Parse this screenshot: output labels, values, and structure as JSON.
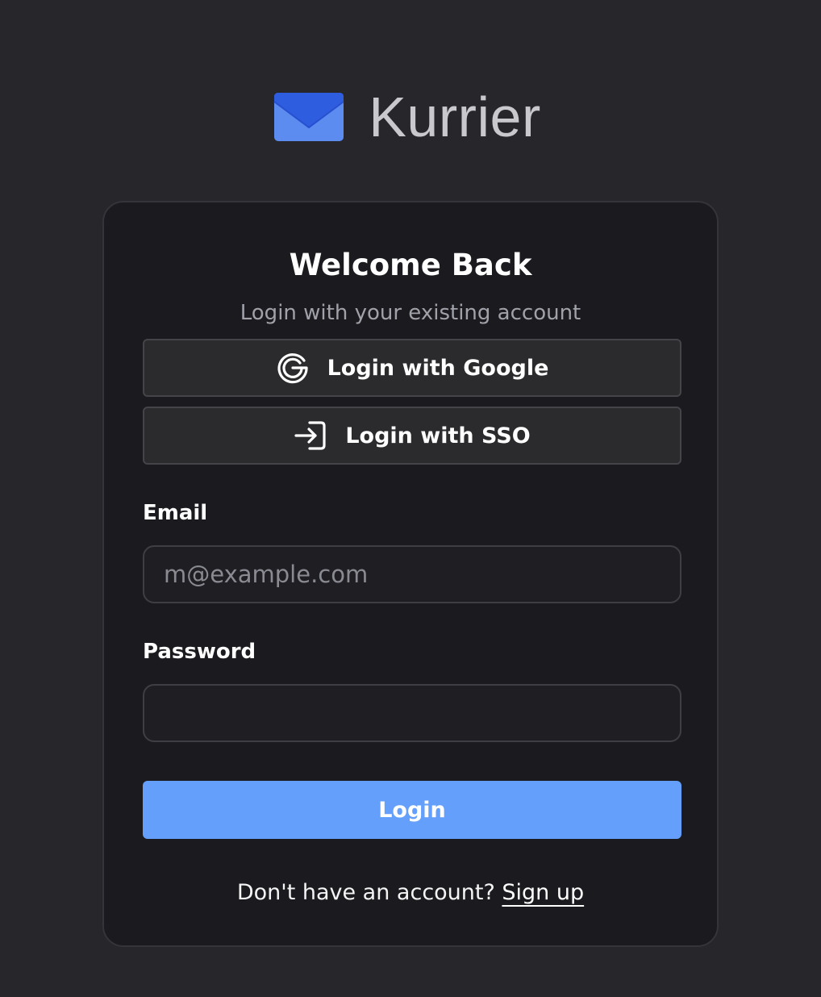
{
  "brand": {
    "name": "Kurrier",
    "icon": "envelope-icon",
    "color": "#3b67e8"
  },
  "card": {
    "title": "Welcome Back",
    "subtitle": "Login with your existing account"
  },
  "oauth": {
    "google": {
      "label": "Login with Google",
      "icon": "google-icon"
    },
    "sso": {
      "label": "Login with SSO",
      "icon": "sign-in-icon"
    }
  },
  "form": {
    "email": {
      "label": "Email",
      "placeholder": "m@example.com",
      "value": ""
    },
    "password": {
      "label": "Password",
      "placeholder": "",
      "value": ""
    },
    "submit_label": "Login",
    "submit_color": "#64a0fb"
  },
  "footer": {
    "prompt": "Don't have an account?",
    "link_label": "Sign up"
  }
}
